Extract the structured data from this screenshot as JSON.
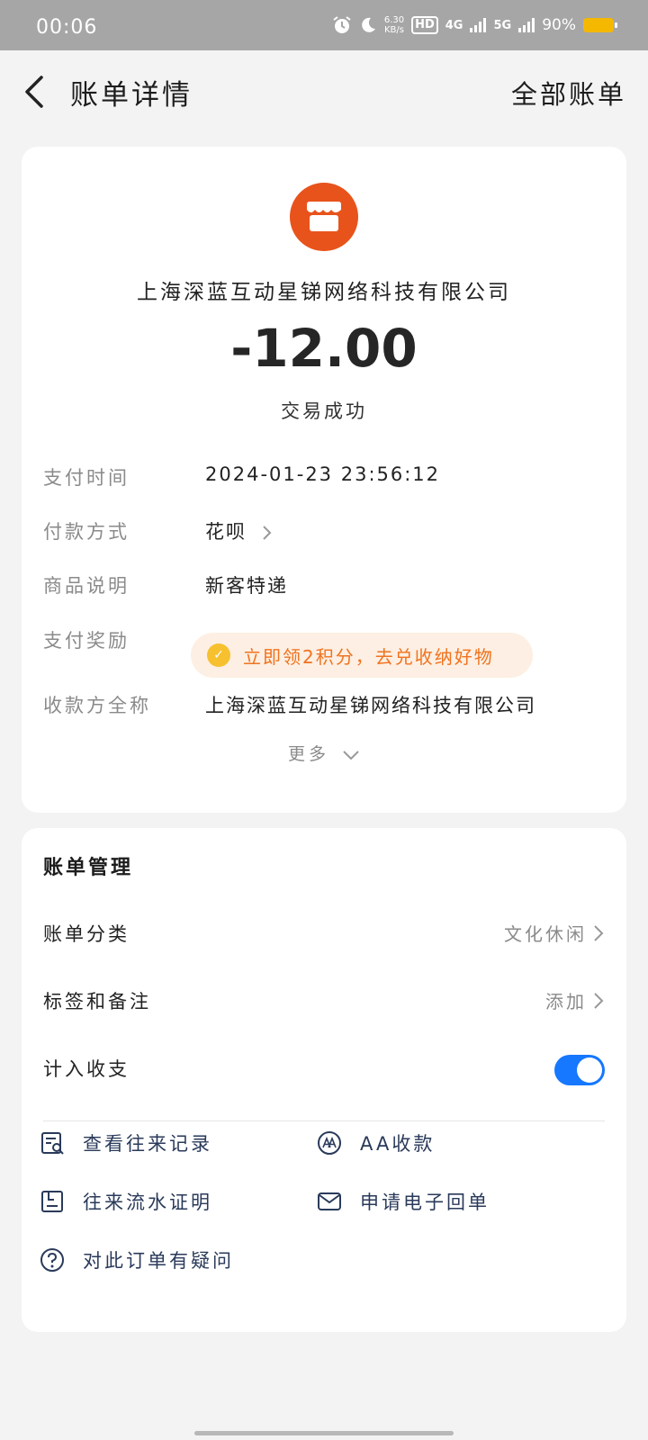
{
  "status_bar": {
    "time": "00:06",
    "speed_value": "6.30",
    "speed_unit": "KB/s",
    "hd": "HD",
    "net1": "4G",
    "net2": "5G",
    "battery": "90%"
  },
  "header": {
    "title": "账单详情",
    "all_bills": "全部账单"
  },
  "summary": {
    "merchant": "上海深蓝互动星锑网络科技有限公司",
    "amount": "-12.00",
    "status": "交易成功"
  },
  "details": [
    {
      "label": "支付时间",
      "value": "2024-01-23 23:56:12"
    },
    {
      "label": "付款方式",
      "value": "花呗"
    },
    {
      "label": "商品说明",
      "value": "新客特递"
    },
    {
      "label": "支付奖励",
      "value": "立即领2积分，去兑收纳好物"
    },
    {
      "label": "收款方全称",
      "value": "上海深蓝互动星锑网络科技有限公司"
    }
  ],
  "more_label": "更多",
  "management": {
    "title": "账单管理",
    "rows": [
      {
        "label": "账单分类",
        "value": "文化休闲"
      },
      {
        "label": "标签和备注",
        "value": "添加"
      },
      {
        "label": "计入收支",
        "value": ""
      }
    ],
    "include_in_budget": true,
    "actions": [
      {
        "label": "查看往来记录",
        "icon": "record-search-icon"
      },
      {
        "label": "AA收款",
        "icon": "aa-icon"
      },
      {
        "label": "往来流水证明",
        "icon": "statement-icon"
      },
      {
        "label": "申请电子回单",
        "icon": "mail-icon"
      },
      {
        "label": "对此订单有疑问",
        "icon": "question-icon"
      }
    ]
  },
  "colors": {
    "accent_blue": "#1677ff",
    "merchant_orange": "#e8531b",
    "reward_orange": "#f0731e"
  }
}
